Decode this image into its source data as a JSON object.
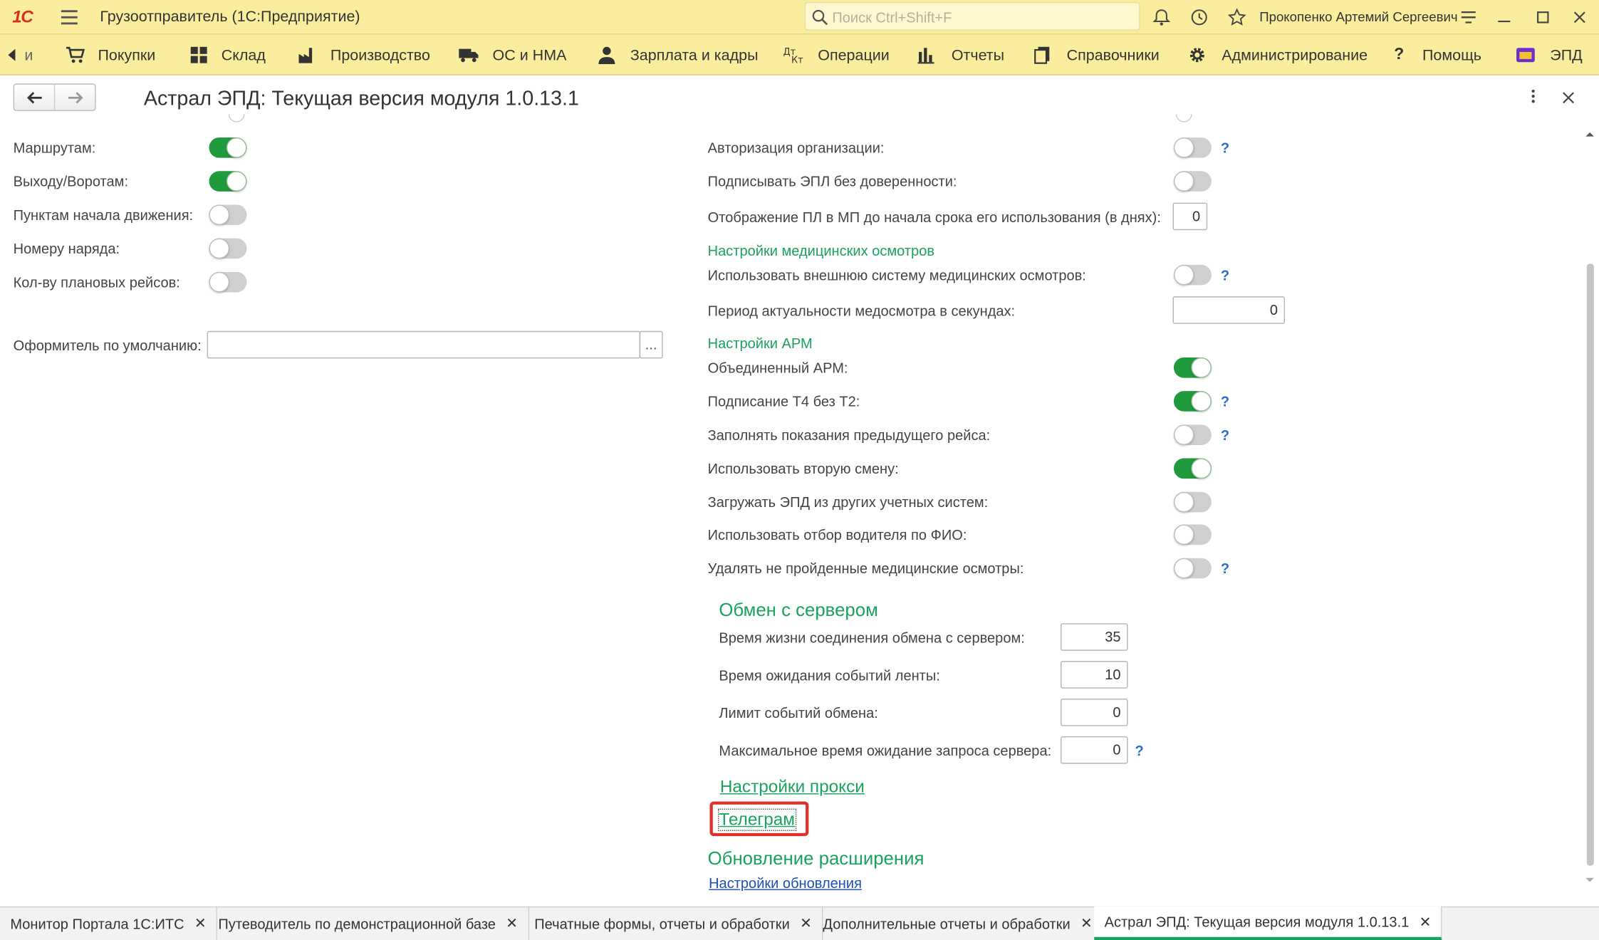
{
  "app": {
    "logo": "1С",
    "title": "Грузоотправитель (1С:Предприятие)",
    "search_placeholder": "Поиск Ctrl+Shift+F",
    "user": "Прокопенко Артемий Сергеевич"
  },
  "nav": {
    "scroll_left_label": "и",
    "items": [
      "Покупки",
      "Склад",
      "Производство",
      "ОС и НМА",
      "Зарплата и кадры",
      "Операции",
      "Отчеты",
      "Справочники",
      "Администрирование",
      "Помощь",
      "ЭПД"
    ]
  },
  "form": {
    "title": "Астрал ЭПД: Текущая версия модуля 1.0.13.1"
  },
  "left": {
    "toggles": [
      {
        "label": "Маршрутам:",
        "on": true
      },
      {
        "label": "Выходу/Воротам:",
        "on": true
      },
      {
        "label": "Пунктам начала движения:",
        "on": false
      },
      {
        "label": "Номеру наряда:",
        "on": false
      },
      {
        "label": "Кол-ву плановых рейсов:",
        "on": false
      }
    ],
    "default_issuer_label": "Оформитель по умолчанию:",
    "default_issuer_value": "",
    "select_btn": "..."
  },
  "right": {
    "org_auth": "Авторизация организации:",
    "sign_epl": "Подписывать ЭПЛ без доверенности:",
    "pl_display": "Отображение ПЛ в МП до начала срока его использования (в днях):",
    "pl_display_value": "0",
    "med_section": "Настройки медицинских осмотров",
    "ext_med": "Использовать внешнюю систему медицинских осмотров:",
    "med_period": "Период актуальности медосмотра в секундах:",
    "med_period_value": "0",
    "arm_section": "Настройки АРМ",
    "arm_united": "Объединенный АРМ:",
    "sign_t4": "Подписание Т4 без Т2:",
    "fill_prev": "Заполнять показания предыдущего рейса:",
    "second_shift": "Использовать вторую смену:",
    "load_epd": "Загружать ЭПД из других учетных систем:",
    "driver_filter": "Использовать отбор водителя по ФИО:",
    "delete_failed": "Удалять не пройденные медицинские осмотры:",
    "toggle_states": {
      "org_auth": false,
      "sign_epl": false,
      "ext_med": false,
      "arm_united": true,
      "sign_t4": true,
      "fill_prev": false,
      "second_shift": true,
      "load_epd": false,
      "driver_filter": false,
      "delete_failed": false
    },
    "help": "?"
  },
  "server": {
    "title": "Обмен с сервером",
    "lifetime_label": "Время жизни соединения обмена с сервером:",
    "lifetime_value": "35",
    "wait_label": "Время ожидания событий ленты:",
    "wait_value": "10",
    "limit_label": "Лимит событий обмена:",
    "limit_value": "0",
    "max_wait_label": "Максимальное время ожидание запроса сервера:",
    "max_wait_value": "0"
  },
  "links": {
    "proxy": "Настройки прокси",
    "telegram": "Телеграм",
    "update_title": "Обновление расширения",
    "update_settings": "Настройки обновления"
  },
  "tabs": [
    {
      "label": "Монитор Портала 1С:ИТС",
      "active": false
    },
    {
      "label": "Путеводитель по демонстрационной базе",
      "active": false
    },
    {
      "label": "Печатные формы, отчеты и обработки",
      "active": false
    },
    {
      "label": "Дополнительные отчеты и обработки",
      "active": false
    },
    {
      "label": "Астрал ЭПД: Текущая версия модуля 1.0.13.1",
      "active": true
    }
  ],
  "tab_close": "✕",
  "colors": {
    "header_bg": "#fbed9e",
    "accent_green": "#1aa35c",
    "toggle_on": "#1f9a3c",
    "link_blue": "#1e4fb7",
    "highlight_red": "#e0302a"
  }
}
